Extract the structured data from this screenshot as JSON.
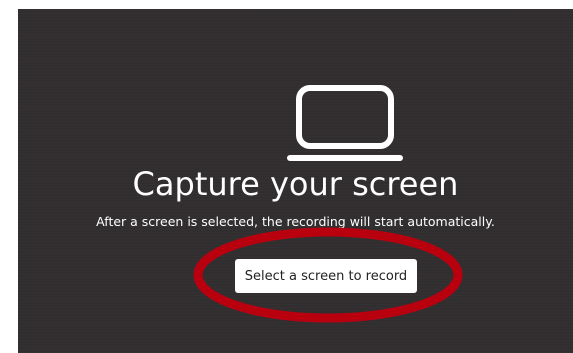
{
  "capture": {
    "icon": "laptop-icon",
    "title": "Capture your screen",
    "subtitle": "After a screen is selected, the recording will start automatically.",
    "select_button_label": "Select a screen to record"
  },
  "annotation": {
    "highlight_color": "#b8000f"
  },
  "colors": {
    "panel_background": "#322f31",
    "text": "#ffffff",
    "button_background": "#ffffff",
    "button_text": "#222222"
  }
}
